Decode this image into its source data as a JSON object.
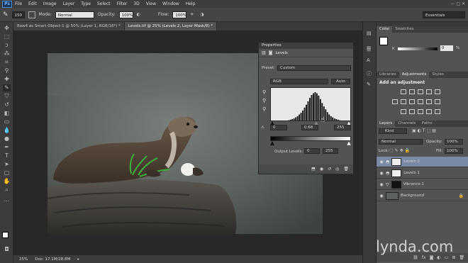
{
  "menu": {
    "logo": "Ps",
    "items": [
      "File",
      "Edit",
      "Image",
      "Layer",
      "Type",
      "Select",
      "Filter",
      "3D",
      "View",
      "Window",
      "Help"
    ]
  },
  "options": {
    "brush_size": "150",
    "mode_label": "Mode:",
    "mode_value": "Normal",
    "opacity_label": "Opacity:",
    "opacity_value": "100%",
    "flow_label": "Flow:",
    "flow_value": "100%",
    "workspace": "Essentials"
  },
  "tabs": [
    "Raw4 as Smart Object-1 @ 50% (Layer 1, RGB/16*) *",
    "Levels.tif @ 25% (Levels 2, Layer Mask/8) *"
  ],
  "status": {
    "zoom": "25%",
    "doc": "Doc: 17.1M/28.8M"
  },
  "properties": {
    "title": "Properties",
    "type": "Levels",
    "preset_label": "Preset:",
    "preset_value": "Custom",
    "channel": "RGB",
    "auto_label": "Auto",
    "input_black": "0",
    "input_gamma": "0.68",
    "input_white": "255",
    "output_label": "Output Levels:",
    "output_black": "0",
    "output_white": "255"
  },
  "color_panel": {
    "tabs": [
      "Color",
      "Swatches"
    ],
    "k_label": "K",
    "k_value": "0",
    "pct": "%"
  },
  "adjust_panel": {
    "tabs": [
      "Libraries",
      "Adjustments",
      "Styles"
    ],
    "heading": "Add an adjustment"
  },
  "layers_panel": {
    "tabs": [
      "Layers",
      "Channels",
      "Paths"
    ],
    "kind": "Kind",
    "blend": "Normal",
    "opacity_label": "Opacity:",
    "opacity_value": "100%",
    "lock_label": "Lock:",
    "fill_label": "Fill:",
    "fill_value": "100%",
    "layers": [
      {
        "name": "Levels 2"
      },
      {
        "name": "Levels 1"
      },
      {
        "name": "Vibrance 1"
      },
      {
        "name": "Background"
      }
    ]
  },
  "watermark": "lynda.com",
  "histogram_values": [
    0,
    0,
    0,
    0,
    1,
    1,
    1,
    2,
    2,
    3,
    4,
    5,
    6,
    8,
    10,
    13,
    16,
    20,
    25,
    30,
    36,
    42,
    47,
    50,
    52,
    50,
    46,
    40,
    33,
    27,
    22,
    17,
    13,
    10,
    8,
    6,
    5,
    4,
    3,
    2,
    2,
    1,
    1,
    1,
    0,
    0
  ]
}
